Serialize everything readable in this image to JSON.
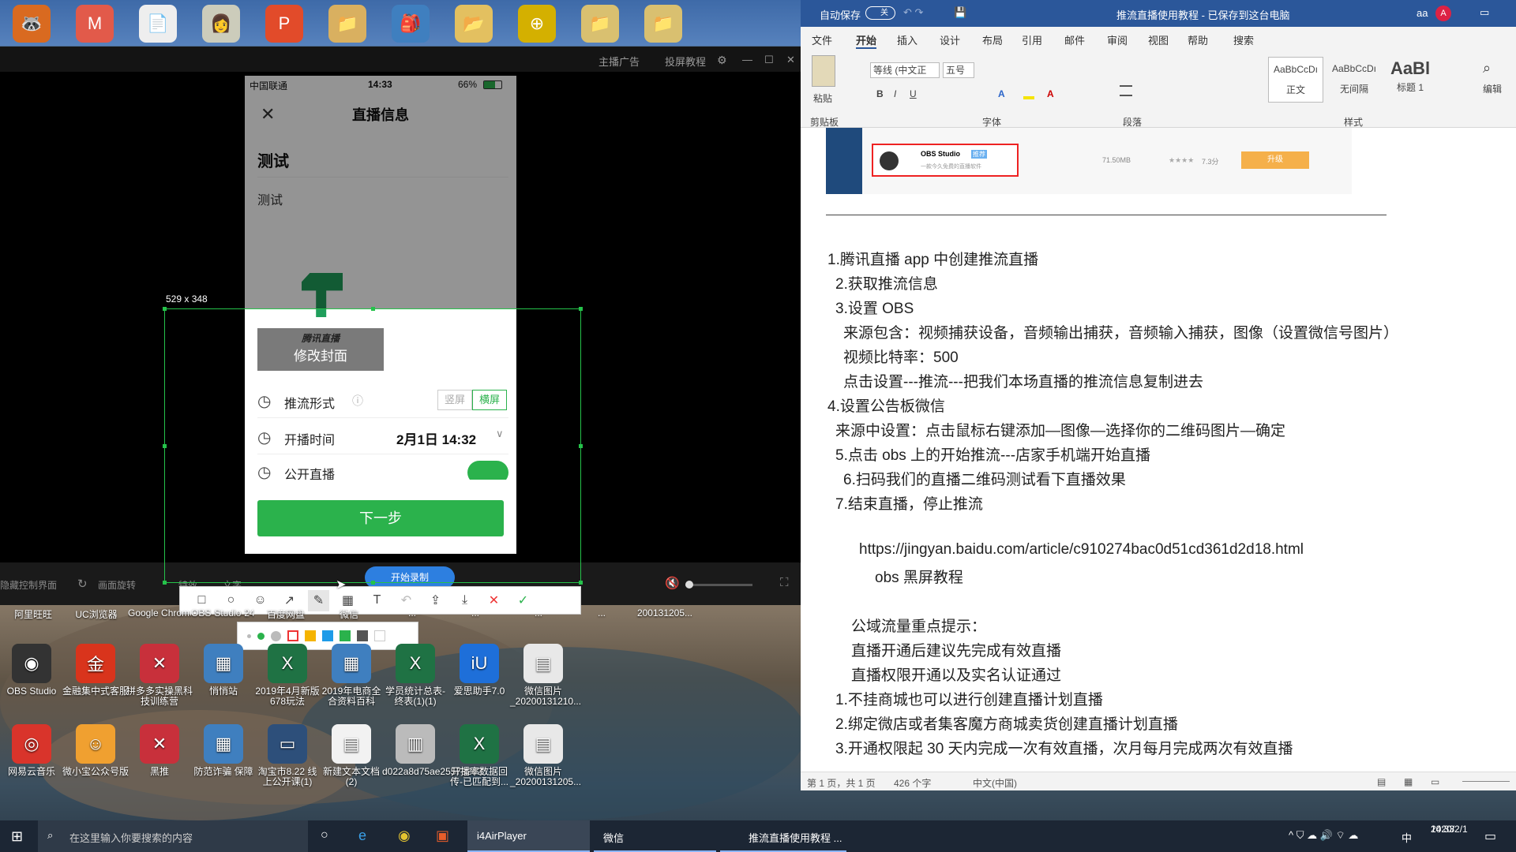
{
  "top_icons": [
    "🦝",
    "M",
    "📄",
    "👩",
    "P",
    "📁",
    "🎒",
    "📂",
    "⊕",
    "📁",
    "📁"
  ],
  "player": {
    "title_ad": "主播广告",
    "title_tutorial": "投屏教程",
    "size_label": "529 x 348",
    "bottom_left": "隐藏控制界面",
    "bottom_rotate": "画面旋转",
    "bottom_fx": "特效",
    "bottom_text": "文字",
    "record_button": "开始录制"
  },
  "phone": {
    "carrier": "中国联通",
    "time": "14:33",
    "battery": "66%",
    "header_title": "直播信息",
    "room_title": "测试",
    "room_desc": "测试",
    "cover_brand": "腾讯直播",
    "cover_change": "修改封面",
    "stream_mode_label": "推流形式",
    "mode_portrait": "竖屏",
    "mode_landscape": "横屏",
    "start_time_label": "开播时间",
    "start_time_value": "2月1日 14:32",
    "public_label": "公开直播",
    "next_button": "下一步"
  },
  "desktop_labels_row1": [
    "阿里旺旺",
    "UC浏览器",
    "Google Chrome",
    "OBS-Studio-24.0.3-Full...",
    "百度网盘",
    "微信",
    "...",
    "...",
    "...",
    "...",
    "200131205..."
  ],
  "desktop_icons": [
    {
      "label": "OBS Studio",
      "glyph": "◉",
      "bg": "#333"
    },
    {
      "label": "金融集中式客服",
      "glyph": "金",
      "bg": "#d9341c"
    },
    {
      "label": "拼多多实操黑科技训练营",
      "glyph": "✕",
      "bg": "#c8303b"
    },
    {
      "label": "悄悄站",
      "glyph": "▦",
      "bg": "#3f7fbf"
    },
    {
      "label": "2019年4月新版678玩法",
      "glyph": "X",
      "bg": "#1f7244"
    },
    {
      "label": "2019年电商全合资料百科",
      "glyph": "▦",
      "bg": "#3f7fbf"
    },
    {
      "label": "学员统计总表-终表(1)(1)",
      "glyph": "X",
      "bg": "#1f7244"
    },
    {
      "label": "爱思助手7.0",
      "glyph": "iU",
      "bg": "#1e6fd9"
    },
    {
      "label": "微信图片_20200131210...",
      "glyph": "▤",
      "bg": "#e8e8e8"
    },
    {
      "label": "网易云音乐",
      "glyph": "◎",
      "bg": "#d9342b"
    },
    {
      "label": "微小宝公众号版",
      "glyph": "☺",
      "bg": "#f0a030"
    },
    {
      "label": "黑推",
      "glyph": "✕",
      "bg": "#c8303b"
    },
    {
      "label": "防范诈骗 保障",
      "glyph": "▦",
      "bg": "#3f7fbf"
    },
    {
      "label": "淘宝市8.22 线上公开课(1)",
      "glyph": "▭",
      "bg": "#2d4f7a"
    },
    {
      "label": "新建文本文档(2)",
      "glyph": "▤",
      "bg": "#f2f2f2"
    },
    {
      "label": "d022a8d75ae255732d2...",
      "glyph": "▥",
      "bg": "#bbb"
    },
    {
      "label": "开播率数据回传-已匹配到...",
      "glyph": "X",
      "bg": "#1f7244"
    },
    {
      "label": "微信图片_20200131205...",
      "glyph": "▤",
      "bg": "#e8e8e8"
    }
  ],
  "word": {
    "autosave": "自动保存",
    "autosave_state": "关",
    "title": "推流直播使用教程 - 已保存到这台电脑",
    "user_initials": "aa",
    "avatar": "A",
    "tabs": [
      "文件",
      "开始",
      "插入",
      "设计",
      "布局",
      "引用",
      "邮件",
      "审阅",
      "视图",
      "帮助",
      "搜索"
    ],
    "ribbon": {
      "paste": "粘贴",
      "clipboard": "剪贴板",
      "font_name": "等线 (中文正",
      "font_size": "五号",
      "font_group": "字体",
      "para_group": "段落",
      "styles_group": "样式",
      "style1_preview": "AaBbCcDı",
      "style1": "正文",
      "style2_preview": "AaBbCcDı",
      "style2": "无间隔",
      "style3_preview": "AaBl",
      "style3": "标题 1",
      "edit": "编辑"
    },
    "embedded": {
      "name": "OBS Studio",
      "badge": "推荐",
      "sub": "一款今久免费的直播软件",
      "size": "71.50MB",
      "rating": "★★★★",
      "score": "7.3分",
      "button": "升级"
    },
    "lines": [
      "1.腾讯直播 app 中创建推流直播",
      "2.获取推流信息",
      "3.设置 OBS",
      "来源包含：视频捕获设备，音频输出捕获，音频输入捕获，图像（设置微信号图片）",
      "视频比特率：500",
      "点击设置---推流---把我们本场直播的推流信息复制进去",
      "4.设置公告板微信",
      "来源中设置：点击鼠标右键添加—图像—选择你的二维码图片—确定",
      "5.点击 obs 上的开始推流---店家手机端开始直播",
      "6.扫码我们的直播二维码测试看下直播效果",
      "7.结束直播，停止推流",
      "https://jingyan.baidu.com/article/c910274bac0d51cd361d2d18.html",
      "obs 黑屏教程",
      "公域流量重点提示：",
      "直播开通后建议先完成有效直播",
      "直播权限开通以及实名认证通过",
      "1.不挂商城也可以进行创建直播计划直播",
      "2.绑定微店或者集客魔方商城卖货创建直播计划直播",
      "3.开通权限起 30 天内完成一次有效直播，次月每月完成两次有效直播"
    ],
    "status_page": "第 1 页，共 1 页",
    "status_words": "426 个字",
    "status_lang": "中文(中国)"
  },
  "taskbar": {
    "search_placeholder": "在这里输入你要搜索的内容",
    "app1": "i4AirPlayer",
    "app2": "微信",
    "app3": "推流直播使用教程 ...",
    "ime": "中",
    "time": "14:33",
    "date": "2020/2/1"
  }
}
